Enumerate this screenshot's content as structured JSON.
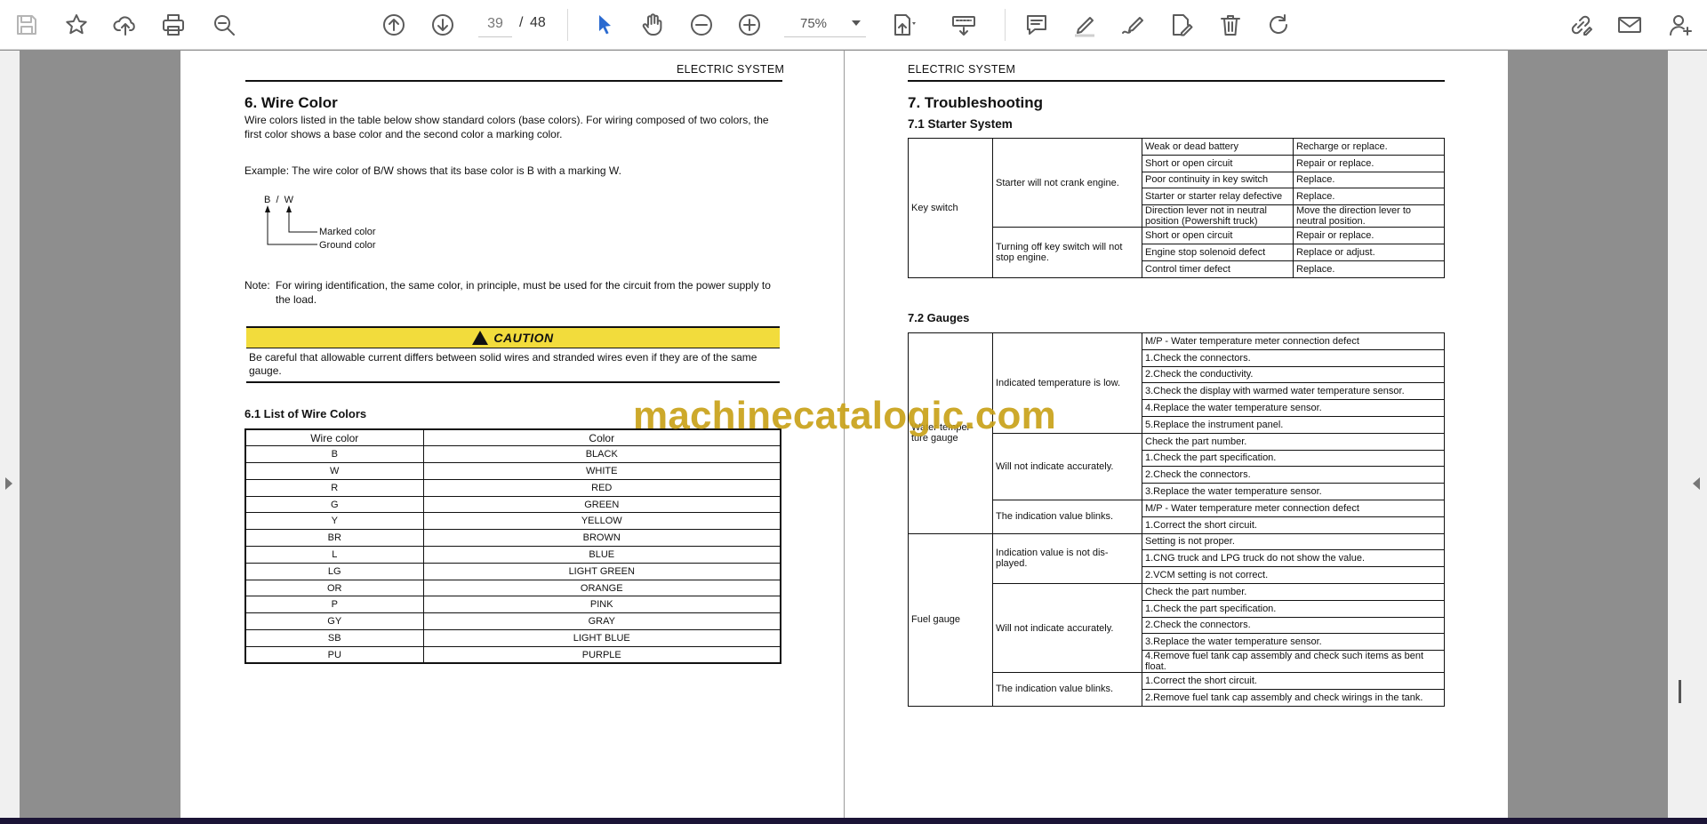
{
  "toolbar": {
    "page_current": "39",
    "page_separator": "/",
    "page_total": "48",
    "zoom": "75%"
  },
  "left_page": {
    "header": "ELECTRIC SYSTEM",
    "section_title": "6.  Wire Color",
    "intro": "Wire colors listed in the table below show standard colors (base colors). For wiring composed of two colors, the first color shows a base color and the second color a marking color.",
    "example": "Example: The wire color of B/W shows that its base color is B with a marking W.",
    "diagram": {
      "code": "B  /  W",
      "marked_label": "Marked color",
      "ground_label": "Ground color"
    },
    "note_label": "Note:",
    "note_text": "For wiring identification, the same color, in principle, must be used for the circuit from the power supply to the load.",
    "caution_title": "CAUTION",
    "caution_text": "Be careful that allowable current differs between solid wires and stranded wires even if they are of the same gauge.",
    "subsection_title": "6.1   List of Wire Colors",
    "wire_table": {
      "headers": [
        "Wire color",
        "Color"
      ],
      "rows": [
        [
          "B",
          "BLACK"
        ],
        [
          "W",
          "WHITE"
        ],
        [
          "R",
          "RED"
        ],
        [
          "G",
          "GREEN"
        ],
        [
          "Y",
          "YELLOW"
        ],
        [
          "BR",
          "BROWN"
        ],
        [
          "L",
          "BLUE"
        ],
        [
          "LG",
          "LIGHT GREEN"
        ],
        [
          "OR",
          "ORANGE"
        ],
        [
          "P",
          "PINK"
        ],
        [
          "GY",
          "GRAY"
        ],
        [
          "SB",
          "LIGHT BLUE"
        ],
        [
          "PU",
          "PURPLE"
        ]
      ]
    }
  },
  "right_page": {
    "header": "ELECTRIC SYSTEM",
    "section_title": "7.  Troubleshooting",
    "starter_title": "7.1   Starter System",
    "starter": {
      "component": "Key switch",
      "groups": [
        {
          "symptom": "Starter will not crank engine.",
          "rows": [
            [
              "Weak or dead battery",
              "Recharge or replace."
            ],
            [
              "Short or open circuit",
              "Repair or replace."
            ],
            [
              "Poor continuity in key switch",
              "Replace."
            ],
            [
              "Starter or starter relay defective",
              "Replace."
            ],
            [
              "Direction lever not in neutral position (Powershift truck)",
              "Move the direction lever to neutral position."
            ]
          ]
        },
        {
          "symptom": "Turning off key switch will not stop engine.",
          "rows": [
            [
              "Short or open circuit",
              "Repair or replace."
            ],
            [
              "Engine stop solenoid defect",
              "Replace or adjust."
            ],
            [
              "Control timer defect",
              "Replace."
            ]
          ]
        }
      ]
    },
    "gauges_title": "7.2   Gauges",
    "gauges": [
      {
        "component": "Water temper- ture gauge",
        "groups": [
          {
            "symptom": "Indicated temperature is low.",
            "rows": [
              "M/P - Water temperature meter connection defect",
              "1.Check the connectors.",
              "2.Check the conductivity.",
              "3.Check the display with warmed water temperature sensor.",
              "4.Replace the water temperature sensor.",
              "5.Replace the instrument panel."
            ]
          },
          {
            "symptom": "Will not indicate accurately.",
            "rows": [
              "Check the part number.",
              "1.Check the part specification.",
              "2.Check the connectors.",
              "3.Replace the water temperature sensor."
            ]
          },
          {
            "symptom": "The indication value blinks.",
            "rows": [
              "M/P - Water temperature meter connection defect",
              "1.Correct the short circuit."
            ]
          }
        ]
      },
      {
        "component": "Fuel gauge",
        "groups": [
          {
            "symptom": "Indication value is not dis- played.",
            "rows": [
              "Setting is not proper.",
              "1.CNG truck and LPG truck do not show the value.",
              "2.VCM setting is not correct."
            ]
          },
          {
            "symptom": "Will not indicate accurately.",
            "rows": [
              "Check the part number.",
              "1.Check the part specification.",
              "2.Check the connectors.",
              "3.Replace the water temperature sensor.",
              "4.Remove fuel tank cap assembly and check such items as bent float."
            ]
          },
          {
            "symptom": "The indication value blinks.",
            "rows": [
              "1.Correct the short circuit.",
              "2.Remove fuel tank cap assembly and check wirings in the tank."
            ]
          }
        ]
      }
    ]
  },
  "watermark": "machinecatalogic.com"
}
